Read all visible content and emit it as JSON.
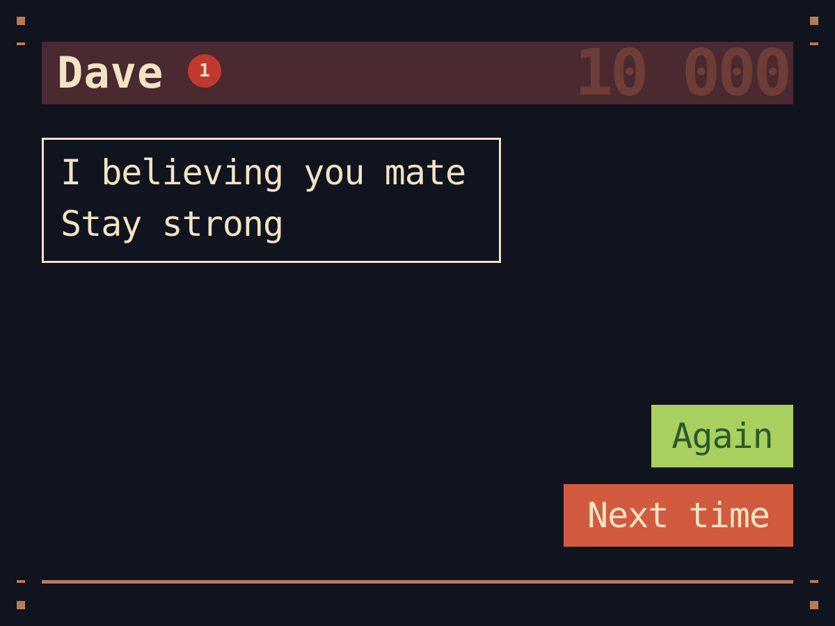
{
  "player": {
    "name": "Dave",
    "level": "1"
  },
  "score": "10 000",
  "message": {
    "line1": "I believing you mate",
    "line2": "Stay strong"
  },
  "buttons": {
    "again": "Again",
    "next_time": "Next time"
  },
  "colors": {
    "background": "#10141e",
    "header": "#4a2930",
    "text": "#f2e3c4",
    "score": "#6e3d38",
    "badge": "#c0392f",
    "again_button": "#a9cf5e",
    "next_button": "#d25a3e",
    "accent": "#b9785a"
  }
}
